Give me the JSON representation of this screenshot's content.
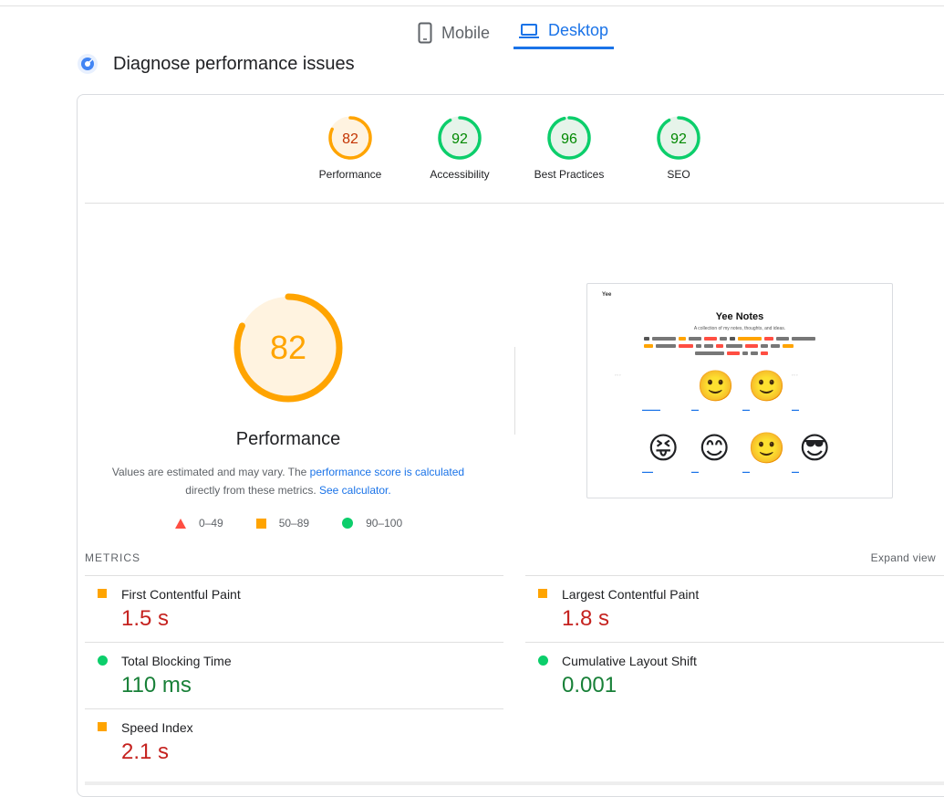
{
  "tabs": {
    "mobile_label": "Mobile",
    "desktop_label": "Desktop",
    "active": "Desktop"
  },
  "section": {
    "title": "Diagnose performance issues"
  },
  "categories": [
    {
      "label": "Performance",
      "score": "82",
      "score_value": 82,
      "status": "average",
      "color": "#ffa400"
    },
    {
      "label": "Accessibility",
      "score": "92",
      "score_value": 92,
      "status": "pass",
      "color": "#0cce6b"
    },
    {
      "label": "Best Practices",
      "score": "96",
      "score_value": 96,
      "status": "pass",
      "color": "#0cce6b"
    },
    {
      "label": "SEO",
      "score": "92",
      "score_value": 92,
      "status": "pass",
      "color": "#0cce6b"
    }
  ],
  "main_gauge": {
    "score": "82",
    "score_value": 82,
    "title": "Performance"
  },
  "note": {
    "text_before": "Values are estimated and may vary. The ",
    "link1": "performance score is calculated",
    "text_middle": "directly from these metrics. ",
    "link2": "See calculator."
  },
  "legend": [
    {
      "range": "0–49",
      "shape": "triangle",
      "color": "#ff4e42"
    },
    {
      "range": "50–89",
      "shape": "square",
      "color": "#ffa400"
    },
    {
      "range": "90–100",
      "shape": "circle",
      "color": "#0cce6b"
    }
  ],
  "screenshot": {
    "brand": "Yee",
    "title": "Yee Notes",
    "subtitle": "A collection of my notes, thoughts, and ideas."
  },
  "metrics": {
    "header": "METRICS",
    "expand_label": "Expand view",
    "items": [
      {
        "name": "First Contentful Paint",
        "value": "1.5 s",
        "status": "average"
      },
      {
        "name": "Largest Contentful Paint",
        "value": "1.8 s",
        "status": "average"
      },
      {
        "name": "Total Blocking Time",
        "value": "110 ms",
        "status": "pass"
      },
      {
        "name": "Cumulative Layout Shift",
        "value": "0.001",
        "status": "pass"
      },
      {
        "name": "Speed Index",
        "value": "2.1 s",
        "status": "average"
      }
    ]
  },
  "colors": {
    "accent": "#1a73e8",
    "average": "#ffa400",
    "pass": "#0cce6b",
    "fail": "#ff4e42"
  }
}
